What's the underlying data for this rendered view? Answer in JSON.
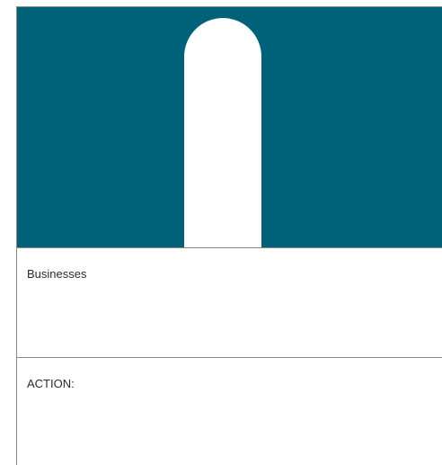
{
  "hero": {
    "background_color": "#006279",
    "arch_color": "#ffffff"
  },
  "sections": [
    {
      "label": "Businesses"
    },
    {
      "label": "ACTION:"
    }
  ]
}
